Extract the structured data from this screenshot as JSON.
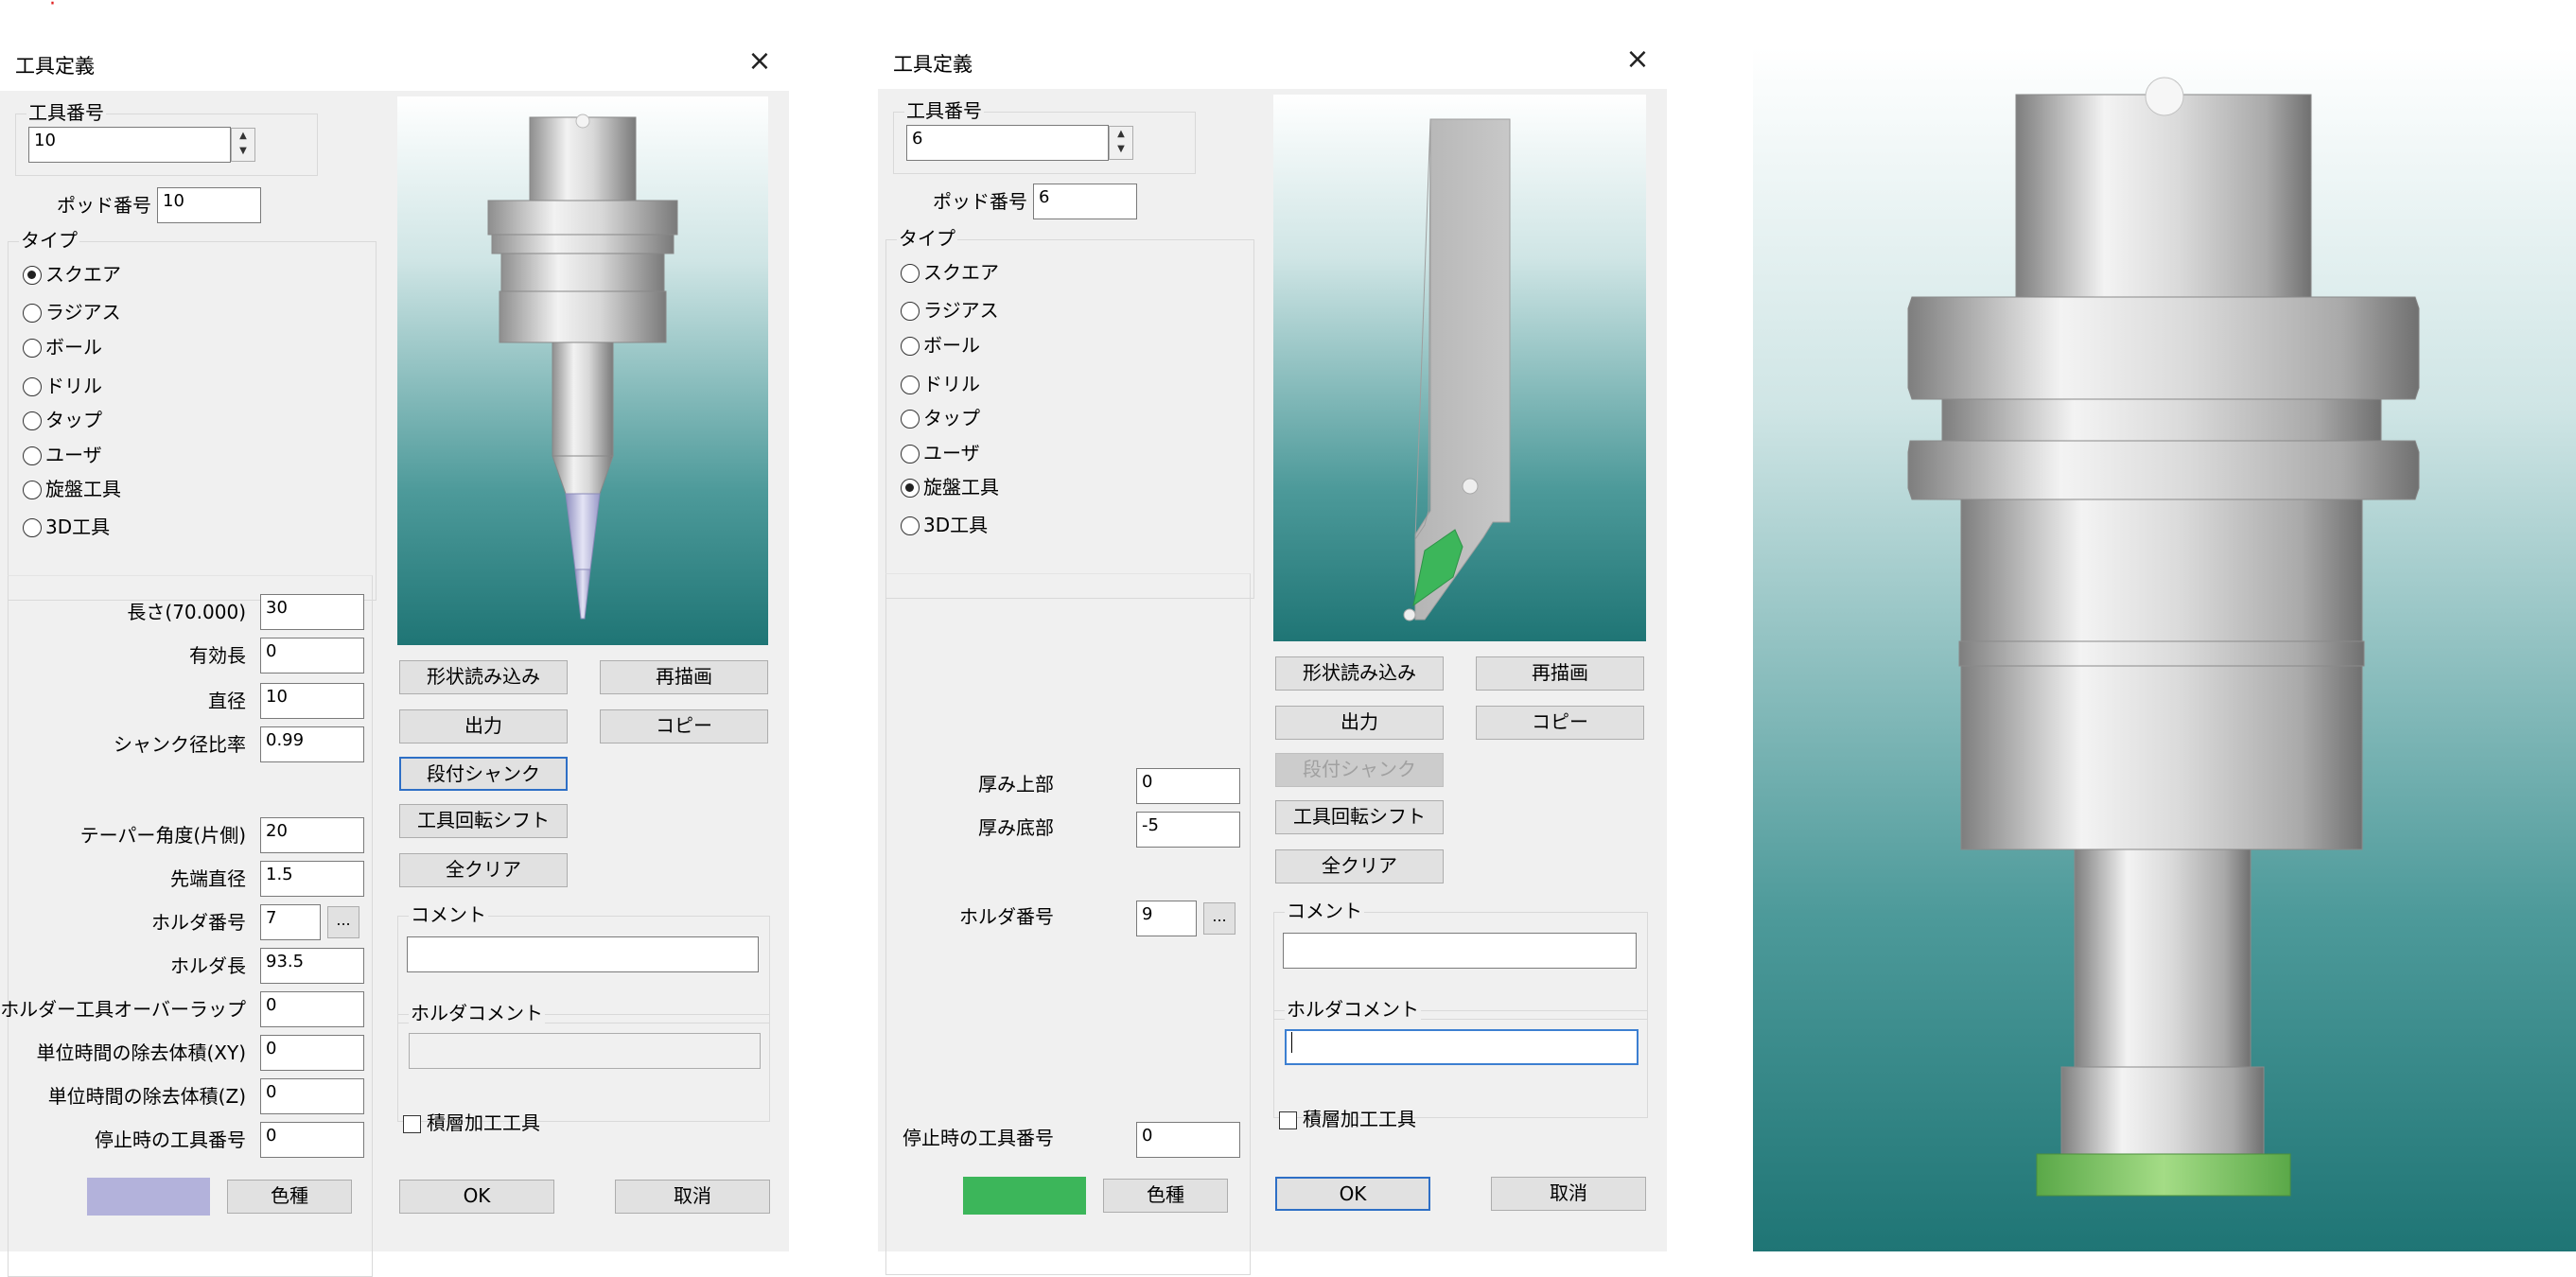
{
  "top_mark": "·",
  "dialog1": {
    "title": "工具定義",
    "tool_number_label": "工具番号",
    "tool_number": "10",
    "pot_number_label": "ポッド番号",
    "pot_number": "10",
    "type_label": "タイプ",
    "types": [
      "スクエア",
      "ラジアス",
      "ボール",
      "ドリル",
      "タップ",
      "ユーザ",
      "旋盤工具",
      "3D工具"
    ],
    "selected_type": "スクエア",
    "fields": [
      {
        "label": "長さ(70.000)",
        "value": "30"
      },
      {
        "label": "有効長",
        "value": "0"
      },
      {
        "label": "直径",
        "value": "10"
      },
      {
        "label": "シャンク径比率",
        "value": "0.99"
      },
      {
        "label": "テーパー角度(片側)",
        "value": "20"
      },
      {
        "label": "先端直径",
        "value": "1.5"
      },
      {
        "label": "ホルダ番号",
        "value": "7"
      },
      {
        "label": "ホルダ長",
        "value": "93.5"
      },
      {
        "label": "ホルダー工具オーバーラップ",
        "value": "0"
      },
      {
        "label": "単位時間の除去体積(XY)",
        "value": "0"
      },
      {
        "label": "単位時間の除去体積(Z)",
        "value": "0"
      },
      {
        "label": "停止時の工具番号",
        "value": "0"
      }
    ],
    "ellipsis": "...",
    "color_button": "色種",
    "swatch_color": "#b3b2db",
    "buttons": {
      "load_shape": "形状読み込み",
      "redraw": "再描画",
      "output": "出力",
      "copy": "コピー",
      "stepped_shank": "段付シャンク",
      "tool_rotation_shift": "工具回転シフト",
      "clear_all": "全クリア"
    },
    "comment_label": "コメント",
    "comment": "",
    "holder_comment_label": "ホルダコメント",
    "holder_comment": "",
    "additive_label": "積層加工工具",
    "ok": "OK",
    "cancel": "取消"
  },
  "dialog2": {
    "title": "工具定義",
    "tool_number_label": "工具番号",
    "tool_number": "6",
    "pot_number_label": "ポッド番号",
    "pot_number": "6",
    "type_label": "タイプ",
    "types": [
      "スクエア",
      "ラジアス",
      "ボール",
      "ドリル",
      "タップ",
      "ユーザ",
      "旋盤工具",
      "3D工具"
    ],
    "selected_type": "旋盤工具",
    "fields": [
      {
        "label": "厚み上部",
        "value": "0"
      },
      {
        "label": "厚み底部",
        "value": "-5"
      },
      {
        "label": "ホルダ番号",
        "value": "9"
      },
      {
        "label": "停止時の工具番号",
        "value": "0"
      }
    ],
    "ellipsis": "...",
    "color_button": "色種",
    "swatch_color": "#3cb65a",
    "buttons": {
      "load_shape": "形状読み込み",
      "redraw": "再描画",
      "output": "出力",
      "copy": "コピー",
      "stepped_shank": "段付シャンク",
      "tool_rotation_shift": "工具回転シフト",
      "clear_all": "全クリア"
    },
    "comment_label": "コメント",
    "comment": "",
    "holder_comment_label": "ホルダコメント",
    "holder_comment": "",
    "additive_label": "積層加工工具",
    "ok": "OK",
    "cancel": "取消"
  },
  "colors": {
    "dialog_bg": "#f0f0f0",
    "preview_top": "#ffffff",
    "preview_bottom": "#1f7575",
    "focus_blue": "#2e6fc6",
    "insert_green": "#3cb65a",
    "tip_lavender": "#b3b2db"
  }
}
